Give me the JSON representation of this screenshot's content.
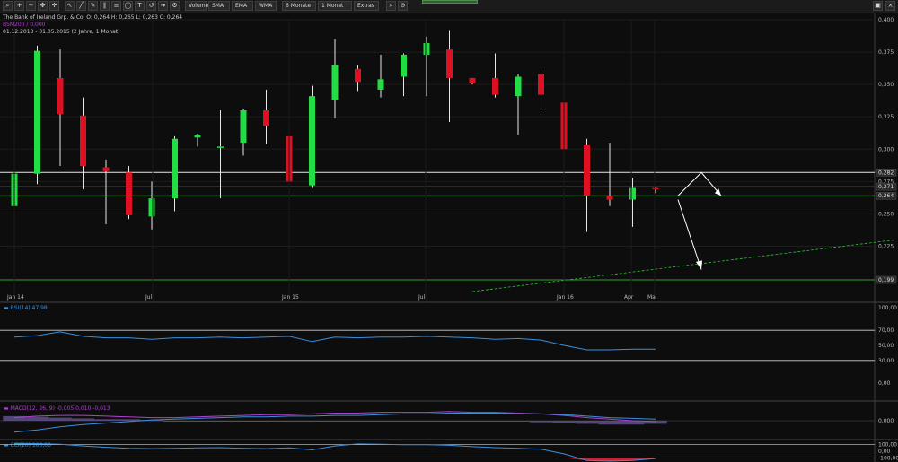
{
  "toolbar": {
    "icons": [
      "search-icon",
      "zoom-in-icon",
      "zoom-out-icon",
      "pan-icon",
      "crosshair-icon"
    ],
    "draw_tools": [
      "cursor-icon",
      "line-icon",
      "brush-icon",
      "channel-icon",
      "fibonacci-icon",
      "ellipse-icon",
      "text-icon",
      "undo-icon",
      "arrow-icon",
      "gear-icon"
    ],
    "buttons": [
      "Volumen",
      "SMA",
      "EMA",
      "WMA"
    ],
    "period": "6 Monate",
    "interval": "1 Monat",
    "extras": "Extras"
  },
  "header": {
    "line1": "The Bank of Ireland Grp. & Co.  O: 0,264  H: 0,265  L: 0,263  C: 0,264",
    "line2": "BSM200 / 0,000",
    "line3": "01.12.2013 - 01.05.2015 (2 Jahre, 1 Monat)"
  },
  "chart_data": [
    {
      "type": "candlestick",
      "title": "",
      "x_tick_labels": [
        "Jan 14",
        "Jul",
        "Jan 15",
        "Jul",
        "Jan 16",
        "Apr",
        "Mai"
      ],
      "y_tick_labels": [
        "0,400",
        "0,375",
        "0,350",
        "0,325",
        "0,300",
        "0,275",
        "0,250",
        "0,225",
        "0,199"
      ],
      "ylim": [
        0.19,
        0.4
      ],
      "candles": [
        {
          "o": 0.256,
          "h": 0.301,
          "l": 0.249,
          "c": 0.281
        },
        {
          "o": 0.281,
          "h": 0.38,
          "l": 0.273,
          "c": 0.376
        },
        {
          "o": 0.355,
          "h": 0.377,
          "l": 0.287,
          "c": 0.327
        },
        {
          "o": 0.326,
          "h": 0.34,
          "l": 0.269,
          "c": 0.287
        },
        {
          "o": 0.286,
          "h": 0.292,
          "l": 0.242,
          "c": 0.283
        },
        {
          "o": 0.282,
          "h": 0.287,
          "l": 0.246,
          "c": 0.249
        },
        {
          "o": 0.248,
          "h": 0.275,
          "l": 0.238,
          "c": 0.262
        },
        {
          "o": 0.262,
          "h": 0.31,
          "l": 0.252,
          "c": 0.308
        },
        {
          "o": 0.309,
          "h": 0.312,
          "l": 0.302,
          "c": 0.311
        },
        {
          "o": 0.302,
          "h": 0.33,
          "l": 0.262,
          "c": 0.302
        },
        {
          "o": 0.305,
          "h": 0.331,
          "l": 0.295,
          "c": 0.33
        },
        {
          "o": 0.33,
          "h": 0.346,
          "l": 0.304,
          "c": 0.318
        },
        {
          "o": 0.31,
          "h": 0.32,
          "l": 0.262,
          "c": 0.275
        },
        {
          "o": 0.272,
          "h": 0.349,
          "l": 0.27,
          "c": 0.341
        },
        {
          "o": 0.338,
          "h": 0.385,
          "l": 0.324,
          "c": 0.365
        },
        {
          "o": 0.362,
          "h": 0.365,
          "l": 0.345,
          "c": 0.352
        },
        {
          "o": 0.346,
          "h": 0.373,
          "l": 0.34,
          "c": 0.354
        },
        {
          "o": 0.356,
          "h": 0.374,
          "l": 0.341,
          "c": 0.373
        },
        {
          "o": 0.373,
          "h": 0.387,
          "l": 0.341,
          "c": 0.382
        },
        {
          "o": 0.377,
          "h": 0.392,
          "l": 0.321,
          "c": 0.355
        },
        {
          "o": 0.355,
          "h": 0.355,
          "l": 0.35,
          "c": 0.351
        },
        {
          "o": 0.355,
          "h": 0.374,
          "l": 0.34,
          "c": 0.342
        },
        {
          "o": 0.341,
          "h": 0.358,
          "l": 0.311,
          "c": 0.356
        },
        {
          "o": 0.358,
          "h": 0.361,
          "l": 0.33,
          "c": 0.342
        },
        {
          "o": 0.336,
          "h": 0.343,
          "l": 0.284,
          "c": 0.3
        },
        {
          "o": 0.303,
          "h": 0.308,
          "l": 0.236,
          "c": 0.264
        },
        {
          "o": 0.264,
          "h": 0.305,
          "l": 0.256,
          "c": 0.261
        },
        {
          "o": 0.261,
          "h": 0.278,
          "l": 0.24,
          "c": 0.27
        },
        {
          "o": 0.27,
          "h": 0.271,
          "l": 0.266,
          "c": 0.269
        }
      ],
      "horizontal_lines": [
        {
          "value": 0.282,
          "label": "0,282",
          "color": "#e8e8e8"
        },
        {
          "value": 0.271,
          "label": "0,271",
          "color": "#5a5a5a"
        },
        {
          "value": 0.264,
          "label": "0,264",
          "color": "#2f9e2f"
        },
        {
          "value": 0.199,
          "label": "0,199",
          "color": "#2f9e2f"
        }
      ],
      "trendline": {
        "from": {
          "candle": 20,
          "value": 0.19
        },
        "to": {
          "candle": 38.5,
          "value": 0.23
        },
        "color": "#2fbf2f"
      },
      "colors": {
        "up": "#22dd44",
        "down": "#dd1122"
      }
    },
    {
      "type": "line",
      "title": "RSI(14) 47,98",
      "y_tick_labels": [
        "100,00",
        "70,00",
        "50,00",
        "30,00",
        "0,00"
      ],
      "ylim": [
        0,
        100
      ],
      "levels": [
        70,
        30
      ],
      "values": [
        61,
        63,
        68,
        62,
        60,
        60,
        58,
        60,
        60,
        61,
        60,
        61,
        62,
        55,
        61,
        60,
        61,
        61,
        62,
        61,
        60,
        58,
        59,
        57,
        50,
        44,
        44,
        45,
        45
      ],
      "color": "#3a8fdd"
    },
    {
      "type": "line",
      "title": "MACD(12, 26, 9) -0,005  0,010  -0,013",
      "y_tick_labels": [
        "0,000",
        "0,00"
      ],
      "ylim": [
        -0.02,
        0.02
      ],
      "zero_label": "0,000",
      "macd": [
        -0.015,
        -0.012,
        -0.008,
        -0.005,
        -0.003,
        -0.001,
        0.001,
        0.002,
        0.003,
        0.004,
        0.005,
        0.005,
        0.006,
        0.006,
        0.007,
        0.007,
        0.008,
        0.009,
        0.009,
        0.01,
        0.01,
        0.01,
        0.009,
        0.009,
        0.008,
        0.006,
        0.004,
        0.003,
        0.002
      ],
      "signal": [
        0.004,
        0.006,
        0.007,
        0.007,
        0.006,
        0.005,
        0.004,
        0.004,
        0.005,
        0.006,
        0.007,
        0.008,
        0.008,
        0.009,
        0.01,
        0.01,
        0.011,
        0.011,
        0.011,
        0.012,
        0.011,
        0.011,
        0.01,
        0.009,
        0.007,
        0.004,
        0.002,
        0.0,
        -0.001
      ],
      "histogram": [
        0.006,
        0.005,
        0.004,
        0.003,
        0.002,
        0.002,
        0.001,
        0.0,
        0.0,
        -0.001,
        -0.001,
        -0.001,
        -0.001,
        -0.001,
        -0.001,
        -0.001,
        -0.001,
        -0.001,
        -0.001,
        -0.001,
        -0.001,
        -0.001,
        -0.001,
        -0.002,
        -0.003,
        -0.004,
        -0.005,
        -0.005,
        -0.004
      ],
      "colors": {
        "macd": "#3a8fdd",
        "signal": "#b040d0",
        "histogram": "#6a5a9a"
      }
    },
    {
      "type": "line",
      "title": "CCI(20) 100,00",
      "y_tick_labels": [
        "100,00",
        "0,00",
        "-100,00"
      ],
      "ylim": [
        -150,
        150
      ],
      "levels": [
        100,
        -100
      ],
      "values": [
        120,
        115,
        105,
        80,
        60,
        45,
        40,
        45,
        50,
        55,
        45,
        40,
        50,
        20,
        80,
        110,
        105,
        100,
        100,
        90,
        70,
        55,
        45,
        30,
        -40,
        -140,
        -150,
        -140,
        -110
      ],
      "color": "#3a8fdd"
    }
  ]
}
